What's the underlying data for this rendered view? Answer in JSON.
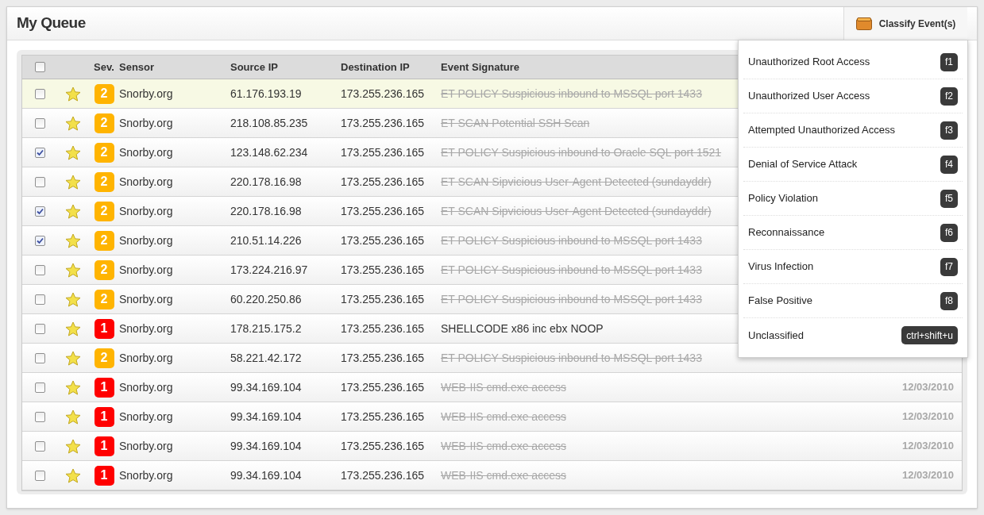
{
  "title": "My Queue",
  "classify_button": {
    "label": "Classify Event(s)"
  },
  "table": {
    "columns": [
      "Sev.",
      "Sensor",
      "Source IP",
      "Destination IP",
      "Event Signature"
    ],
    "all_checked": false,
    "rows": [
      {
        "checked": false,
        "highlighted": true,
        "starred": true,
        "severity": "2",
        "color": "#ffb400",
        "sensor": "Snorby.org",
        "source_ip": "61.176.193.19",
        "destination_ip": "173.255.236.165",
        "signature": "ET POLICY Suspicious inbound to MSSQL port 1433",
        "classified": true
      },
      {
        "checked": false,
        "highlighted": false,
        "starred": true,
        "severity": "2",
        "color": "#ffb400",
        "sensor": "Snorby.org",
        "source_ip": "218.108.85.235",
        "destination_ip": "173.255.236.165",
        "signature": "ET SCAN Potential SSH Scan",
        "classified": true
      },
      {
        "checked": true,
        "highlighted": false,
        "starred": true,
        "severity": "2",
        "color": "#ffb400",
        "sensor": "Snorby.org",
        "source_ip": "123.148.62.234",
        "destination_ip": "173.255.236.165",
        "signature": "ET POLICY Suspicious inbound to Oracle SQL port 1521",
        "classified": true
      },
      {
        "checked": false,
        "highlighted": false,
        "starred": true,
        "severity": "2",
        "color": "#ffb400",
        "sensor": "Snorby.org",
        "source_ip": "220.178.16.98",
        "destination_ip": "173.255.236.165",
        "signature": "ET SCAN Sipvicious User-Agent Detected (sundayddr)",
        "classified": true
      },
      {
        "checked": true,
        "highlighted": false,
        "starred": true,
        "severity": "2",
        "color": "#ffb400",
        "sensor": "Snorby.org",
        "source_ip": "220.178.16.98",
        "destination_ip": "173.255.236.165",
        "signature": "ET SCAN Sipvicious User-Agent Detected (sundayddr)",
        "classified": true
      },
      {
        "checked": true,
        "highlighted": false,
        "starred": true,
        "severity": "2",
        "color": "#ffb400",
        "sensor": "Snorby.org",
        "source_ip": "210.51.14.226",
        "destination_ip": "173.255.236.165",
        "signature": "ET POLICY Suspicious inbound to MSSQL port 1433",
        "classified": true
      },
      {
        "checked": false,
        "highlighted": false,
        "starred": true,
        "severity": "2",
        "color": "#ffb400",
        "sensor": "Snorby.org",
        "source_ip": "173.224.216.97",
        "destination_ip": "173.255.236.165",
        "signature": "ET POLICY Suspicious inbound to MSSQL port 1433",
        "classified": true
      },
      {
        "checked": false,
        "highlighted": false,
        "starred": true,
        "severity": "2",
        "color": "#ffb400",
        "sensor": "Snorby.org",
        "source_ip": "60.220.250.86",
        "destination_ip": "173.255.236.165",
        "signature": "ET POLICY Suspicious inbound to MSSQL port 1433",
        "classified": true
      },
      {
        "checked": false,
        "highlighted": false,
        "starred": true,
        "severity": "1",
        "color": "#ff0000",
        "sensor": "Snorby.org",
        "source_ip": "178.215.175.2",
        "destination_ip": "173.255.236.165",
        "signature": "SHELLCODE x86 inc ebx NOOP",
        "classified": false
      },
      {
        "checked": false,
        "highlighted": false,
        "starred": true,
        "severity": "2",
        "color": "#ffb400",
        "sensor": "Snorby.org",
        "source_ip": "58.221.42.172",
        "destination_ip": "173.255.236.165",
        "signature": "ET POLICY Suspicious inbound to MSSQL port 1433",
        "classified": true
      },
      {
        "checked": false,
        "highlighted": false,
        "starred": true,
        "severity": "1",
        "color": "#ff0000",
        "sensor": "Snorby.org",
        "source_ip": "99.34.169.104",
        "destination_ip": "173.255.236.165",
        "signature": "WEB-IIS cmd.exe access",
        "classified": true,
        "timestamp": "12/03/2010"
      },
      {
        "checked": false,
        "highlighted": false,
        "starred": true,
        "severity": "1",
        "color": "#ff0000",
        "sensor": "Snorby.org",
        "source_ip": "99.34.169.104",
        "destination_ip": "173.255.236.165",
        "signature": "WEB-IIS cmd.exe access",
        "classified": true,
        "timestamp": "12/03/2010"
      },
      {
        "checked": false,
        "highlighted": false,
        "starred": true,
        "severity": "1",
        "color": "#ff0000",
        "sensor": "Snorby.org",
        "source_ip": "99.34.169.104",
        "destination_ip": "173.255.236.165",
        "signature": "WEB-IIS cmd.exe access",
        "classified": true,
        "timestamp": "12/03/2010"
      },
      {
        "checked": false,
        "highlighted": false,
        "starred": true,
        "severity": "1",
        "color": "#ff0000",
        "sensor": "Snorby.org",
        "source_ip": "99.34.169.104",
        "destination_ip": "173.255.236.165",
        "signature": "WEB-IIS cmd.exe access",
        "classified": true,
        "timestamp": "12/03/2010"
      }
    ]
  },
  "classify_menu": [
    {
      "label": "Unauthorized Root Access",
      "shortcut": "f1"
    },
    {
      "label": "Unauthorized User Access",
      "shortcut": "f2"
    },
    {
      "label": "Attempted Unauthorized Access",
      "shortcut": "f3"
    },
    {
      "label": "Denial of Service Attack",
      "shortcut": "f4"
    },
    {
      "label": "Policy Violation",
      "shortcut": "f5"
    },
    {
      "label": "Reconnaissance",
      "shortcut": "f6"
    },
    {
      "label": "Virus Infection",
      "shortcut": "f7"
    },
    {
      "label": "False Positive",
      "shortcut": "f8"
    },
    {
      "label": "Unclassified",
      "shortcut": "ctrl+shift+u"
    }
  ]
}
